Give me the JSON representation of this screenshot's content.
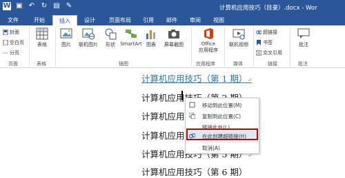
{
  "window": {
    "title": "计算机应用技巧（目录）.docx - Wor"
  },
  "qat_icons": [
    "word-icon",
    "save-icon",
    "undo-icon",
    "redo-icon",
    "print-preview-icon",
    "format-painter-icon"
  ],
  "tabs": {
    "file": "文件",
    "items": [
      "开始",
      "插入",
      "设计",
      "页面布局",
      "引用",
      "邮件",
      "审阅",
      "视图"
    ],
    "active": "插入"
  },
  "ribbon": {
    "pages_group": {
      "label": "页面",
      "buttons": [
        "封面",
        "空白页",
        "分页"
      ]
    },
    "tables_group": {
      "label": "表格",
      "table_label": "表格"
    },
    "illustrations_group": {
      "label": "插图",
      "buttons": [
        "图片",
        "联机图片",
        "形状",
        "SmartArt",
        "图表",
        "屏幕截图"
      ]
    },
    "apps_group": {
      "label": "应用程序",
      "office_app_line1": "Office",
      "office_app_line2": "应用程序"
    },
    "media_group": {
      "label": "媒体",
      "online_video": "联机视频"
    },
    "links_group": {
      "label": "链接",
      "buttons": [
        "超链接",
        "书签",
        "交叉引用"
      ]
    },
    "comments_group": {
      "label": "批注",
      "comment": "批注"
    }
  },
  "document": {
    "lines": [
      "计算机应用技巧（第 1 期）",
      "计算机应用技巧（第 2 期）",
      "计算机应用技",
      "计算机应用技",
      "计算机应用技巧（第 5 期）",
      "计算机应用技巧（第 6 期）"
    ],
    "paragraph_mark": "↵"
  },
  "context_menu": {
    "items": [
      "移动到此位置(M)",
      "复制到此位置(C)",
      "链接此处(L)",
      "在此创建超链接(H)",
      "取消(A)"
    ],
    "highlighted": "在此创建超链接(H)"
  }
}
